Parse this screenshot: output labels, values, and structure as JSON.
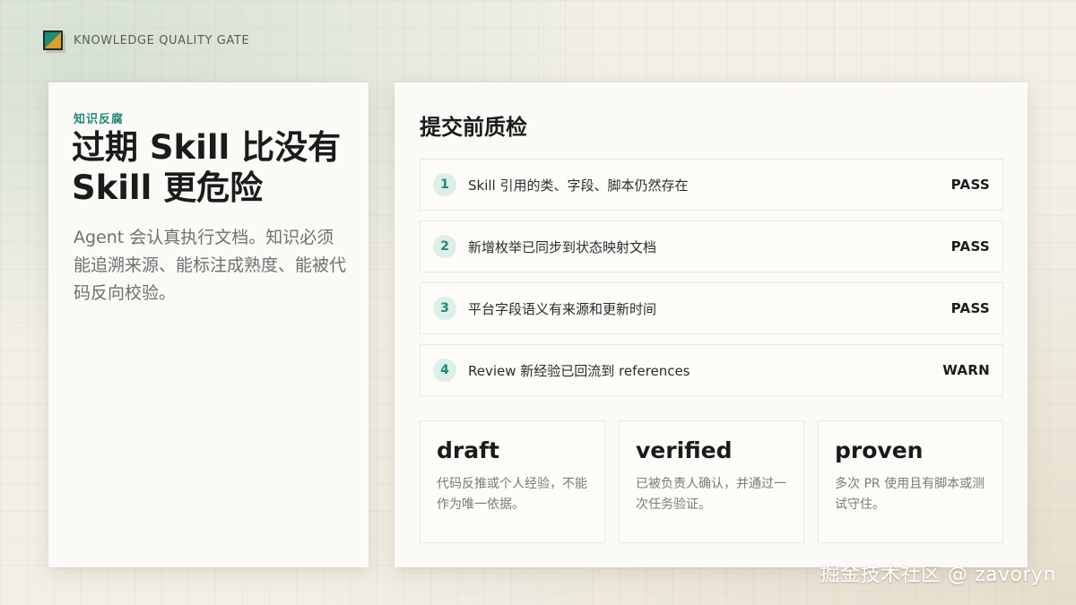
{
  "header": {
    "brand_title": "KNOWLEDGE QUALITY GATE",
    "logo_icon": "square-logo-icon",
    "accent_color": "#1e8a78",
    "secondary_color": "#d9a126"
  },
  "left_panel": {
    "kicker": "知识反腐",
    "headline": "过期 Skill 比没有 Skill 更危险",
    "lede": "Agent 会认真执行文档。知识必须能追溯来源、能标注成熟度、能被代码反向校验。"
  },
  "right_panel": {
    "title": "提交前质检",
    "checks": [
      {
        "num": "1",
        "text": "Skill 引用的类、字段、脚本仍然存在",
        "status": "PASS"
      },
      {
        "num": "2",
        "text": "新增枚举已同步到状态映射文档",
        "status": "PASS"
      },
      {
        "num": "3",
        "text": "平台字段语义有来源和更新时间",
        "status": "PASS"
      },
      {
        "num": "4",
        "text": "Review 新经验已回流到 references",
        "status": "WARN"
      }
    ],
    "levels": [
      {
        "name": "draft",
        "desc": "代码反推或个人经验，不能作为唯一依据。"
      },
      {
        "name": "verified",
        "desc": "已被负责人确认，并通过一次任务验证。"
      },
      {
        "name": "proven",
        "desc": "多次 PR 使用且有脚本或测试守住。"
      }
    ]
  },
  "watermark": "掘金技术社区 @ zavoryn"
}
